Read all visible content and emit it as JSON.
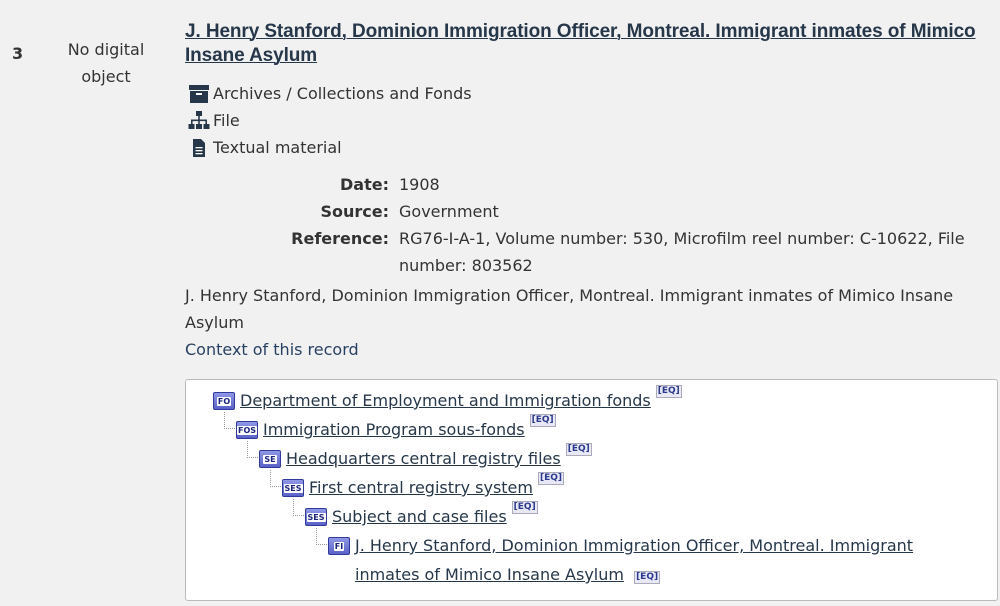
{
  "result": {
    "number": "3",
    "thumbnail_text": "No digital object",
    "title": "J. Henry Stanford, Dominion Immigration Officer, Montreal. Immigrant inmates of Mimico Insane Asylum",
    "meta": {
      "collection": "Archives / Collections and Fonds",
      "level": "File",
      "material": "Textual material"
    },
    "fields": [
      {
        "label": "Date:",
        "value": "1908"
      },
      {
        "label": "Source:",
        "value": "Government"
      },
      {
        "label": "Reference:",
        "value": "RG76-I-A-1, Volume number: 530, Microfilm reel number: C-10622, File number: 803562"
      }
    ],
    "description": "J. Henry Stanford, Dominion Immigration Officer, Montreal. Immigrant inmates of Mimico Insane Asylum",
    "context_link": "Context of this record"
  },
  "hierarchy": [
    {
      "icon": "FO",
      "label": "Department of Employment and Immigration fonds",
      "badge": "[EQ]"
    },
    {
      "icon": "FOS",
      "label": "Immigration Program sous-fonds",
      "badge": "[EQ]"
    },
    {
      "icon": "SE",
      "label": "Headquarters central registry files",
      "badge": "[EQ]"
    },
    {
      "icon": "SES",
      "label": "First central registry system",
      "badge": "[EQ]"
    },
    {
      "icon": "SES",
      "label": "Subject and case files",
      "badge": "[EQ]"
    },
    {
      "icon": "FI",
      "label": "J. Henry Stanford, Dominion Immigration Officer, Montreal. Immigrant inmates of Mimico Insane Asylum",
      "badge": "[EQ]"
    }
  ]
}
